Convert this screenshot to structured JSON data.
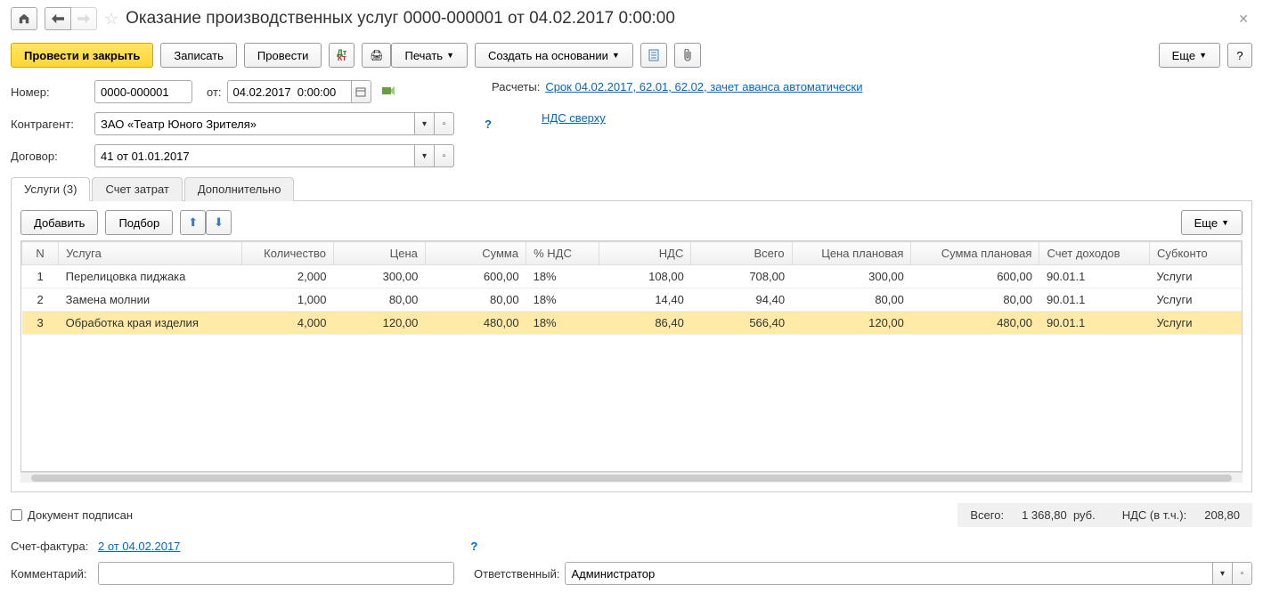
{
  "header": {
    "title": "Оказание производственных услуг 0000-000001 от 04.02.2017 0:00:00"
  },
  "toolbar": {
    "post_close": "Провести и закрыть",
    "save": "Записать",
    "post": "Провести",
    "print": "Печать",
    "create_based": "Создать на основании",
    "more": "Еще",
    "help": "?"
  },
  "form": {
    "number_label": "Номер:",
    "number_value": "0000-000001",
    "from_label": "от:",
    "date_value": "04.02.2017  0:00:00",
    "calc_label": "Расчеты:",
    "calc_value": "Срок 04.02.2017, 62.01, 62.02, зачет аванса автоматически",
    "contragent_label": "Контрагент:",
    "contragent_value": "ЗАО «Театр Юного Зрителя»",
    "vat_link": "НДС сверху",
    "contract_label": "Договор:",
    "contract_value": "41 от 01.01.2017"
  },
  "tabs": {
    "services": "Услуги (3)",
    "cost_account": "Счет затрат",
    "additional": "Дополнительно"
  },
  "table_toolbar": {
    "add": "Добавить",
    "pick": "Подбор",
    "more": "Еще"
  },
  "table": {
    "headers": {
      "n": "N",
      "service": "Услуга",
      "qty": "Количество",
      "price": "Цена",
      "sum": "Сумма",
      "vat_pct": "% НДС",
      "vat": "НДС",
      "total": "Всего",
      "plan_price": "Цена плановая",
      "plan_sum": "Сумма плановая",
      "income_acct": "Счет доходов",
      "subkonto": "Субконто"
    },
    "rows": [
      {
        "n": "1",
        "service": "Перелицовка пиджака",
        "qty": "2,000",
        "price": "300,00",
        "sum": "600,00",
        "vat_pct": "18%",
        "vat": "108,00",
        "total": "708,00",
        "plan_price": "300,00",
        "plan_sum": "600,00",
        "income_acct": "90.01.1",
        "subkonto": "Услуги"
      },
      {
        "n": "2",
        "service": "Замена молнии",
        "qty": "1,000",
        "price": "80,00",
        "sum": "80,00",
        "vat_pct": "18%",
        "vat": "14,40",
        "total": "94,40",
        "plan_price": "80,00",
        "plan_sum": "80,00",
        "income_acct": "90.01.1",
        "subkonto": "Услуги"
      },
      {
        "n": "3",
        "service": "Обработка края изделия",
        "qty": "4,000",
        "price": "120,00",
        "sum": "480,00",
        "vat_pct": "18%",
        "vat": "86,40",
        "total": "566,40",
        "plan_price": "120,00",
        "plan_sum": "480,00",
        "income_acct": "90.01.1",
        "subkonto": "Услуги"
      }
    ]
  },
  "footer": {
    "signed_label": "Документ подписан",
    "total_label": "Всего:",
    "total_value": "1 368,80",
    "currency": "руб.",
    "vat_label": "НДС (в т.ч.):",
    "vat_value": "208,80",
    "invoice_label": "Счет-фактура:",
    "invoice_value": "2 от 04.02.2017",
    "comment_label": "Комментарий:",
    "responsible_label": "Ответственный:",
    "responsible_value": "Администратор"
  }
}
